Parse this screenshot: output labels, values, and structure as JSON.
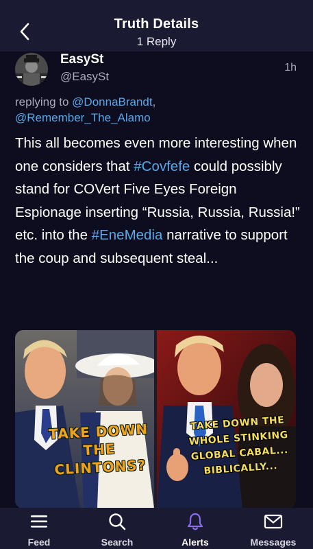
{
  "header": {
    "title": "Truth Details",
    "subtitle": "1 Reply"
  },
  "post": {
    "author_name": "EasySt",
    "author_handle": "@EasySt",
    "time": "1h",
    "replying_label": "replying to ",
    "replying_mentions": [
      "@DonnaBrandt",
      "@Remember_The_Alamo"
    ],
    "body": {
      "part1": "This all becomes even more interesting when one considers that ",
      "hashtag1": "#Covfefe",
      "part2": " could possibly stand for COVert Five Eyes Foreign Espionage inserting “Russia, Russia, Russia!” etc. into the ",
      "hashtag2": "#EneMedia",
      "part3": " narrative to support the coup and subsequent steal..."
    },
    "media": {
      "left_caption": "TAKE DOWN THE CLINTONS?",
      "right_caption": "TAKE DOWN THE WHOLE STINKING GLOBAL CABAL... BIBLICALLY..."
    }
  },
  "tabbar": {
    "tabs": [
      {
        "label": "Feed",
        "icon": "feed-icon"
      },
      {
        "label": "Search",
        "icon": "search-icon"
      },
      {
        "label": "Alerts",
        "icon": "bell-icon"
      },
      {
        "label": "Messages",
        "icon": "envelope-icon"
      }
    ]
  },
  "colors": {
    "background": "#0e0d1f",
    "bar": "#1b1a33",
    "link": "#56a8e8",
    "alerts_accent": "#8b6cf0"
  }
}
